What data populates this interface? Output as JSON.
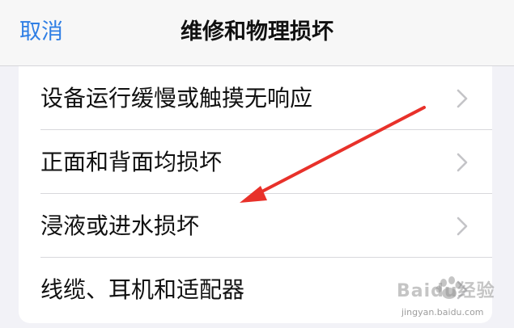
{
  "navbar": {
    "cancel_label": "取消",
    "title": "维修和物理损坏"
  },
  "list": {
    "items": [
      {
        "label": "设备运行缓慢或触摸无响应",
        "icon": "chevron-right-icon"
      },
      {
        "label": "正面和背面均损坏",
        "icon": "chevron-right-icon"
      },
      {
        "label": "浸液或进水损坏",
        "icon": "chevron-right-icon"
      },
      {
        "label": "线缆、耳机和适配器",
        "icon": "chevron-right-icon"
      }
    ]
  },
  "annotation": {
    "arrow_color": "#e8312a",
    "arrow_icon": "red-arrow-icon"
  },
  "watermark": {
    "brand": "Baidu经验",
    "url": "jingyan.baidu.com"
  },
  "colors": {
    "accent": "#2f7fe5",
    "background": "#f2f2f7",
    "card": "#ffffff",
    "separator": "#d8d8dc",
    "chevron": "#c4c4c7"
  }
}
